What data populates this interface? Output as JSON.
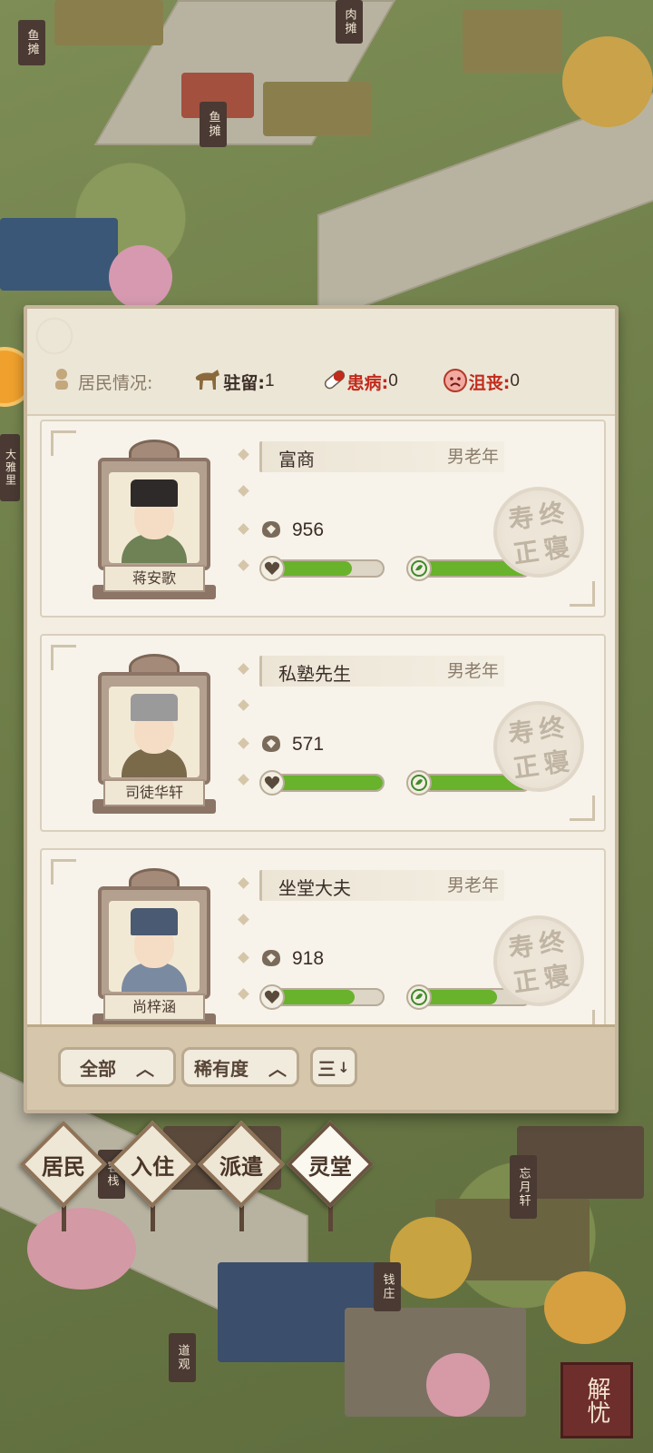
{
  "status": {
    "label": "居民情况:",
    "stationed_label": "驻留:",
    "stationed_value": "1",
    "sick_label": "患病:",
    "sick_value": "0",
    "depressed_label": "沮丧:",
    "depressed_value": "0"
  },
  "residents": [
    {
      "name": "蒋安歌",
      "occupation": "富商",
      "tag": "男老年",
      "wealth": "956",
      "health": 0.72,
      "mood": 1.0,
      "stamp": [
        "寿",
        "终",
        "正",
        "寝"
      ],
      "colors": {
        "hat": "#2e2a2a",
        "body": "#6e8256"
      }
    },
    {
      "name": "司徒华轩",
      "occupation": "私塾先生",
      "tag": "男老年",
      "wealth": "571",
      "health": 1.0,
      "mood": 1.0,
      "stamp": [
        "寿",
        "终",
        "正",
        "寝"
      ],
      "colors": {
        "hat": "#9a9a9a",
        "body": "#7a6a4a"
      }
    },
    {
      "name": "尚梓涵",
      "occupation": "坐堂大夫",
      "tag": "男老年",
      "wealth": "918",
      "health": 0.74,
      "mood": 0.7,
      "stamp": [
        "寿",
        "终",
        "正",
        "寝"
      ],
      "colors": {
        "hat": "#4a5a72",
        "body": "#7a8aa0"
      }
    }
  ],
  "filters": {
    "all_label": "全部",
    "rarity_label": "稀有度",
    "sort_label": "三"
  },
  "nav": [
    {
      "label": "居民",
      "active": false
    },
    {
      "label": "入住",
      "active": false
    },
    {
      "label": "派遣",
      "active": false
    },
    {
      "label": "灵堂",
      "active": true
    }
  ],
  "signs": {
    "fish1": "鱼摊",
    "meat": "肉摊",
    "fish2": "鱼摊",
    "daya": "大雅里",
    "wangyue": "忘月轩",
    "qianzhuang": "钱庄",
    "daoguan": "道观",
    "kezhan": "客栈"
  },
  "logo": "解忧",
  "colors": {
    "bar_green": "#68b22c",
    "sick_red": "#c22a1b",
    "panel_bg": "#f3eee1"
  }
}
